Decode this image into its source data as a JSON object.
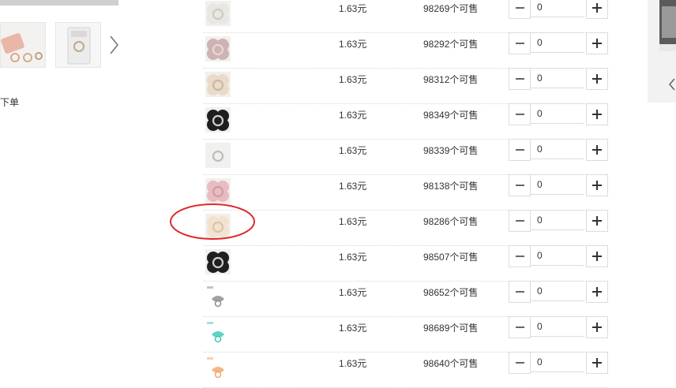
{
  "gallery": {
    "note": "下单"
  },
  "rows": [
    {
      "price": "1.63元",
      "stock": "98269个可售",
      "qty": "0",
      "color": "#e9e7e2",
      "accent": "#cfcac2"
    },
    {
      "price": "1.63元",
      "stock": "98292个可售",
      "qty": "0",
      "color": "#cdb3b3",
      "accent": "#e8d9d3"
    },
    {
      "price": "1.63元",
      "stock": "98312个可售",
      "qty": "0",
      "color": "#eadbc9",
      "accent": "#cbb8a4"
    },
    {
      "price": "1.63元",
      "stock": "98349个可售",
      "qty": "0",
      "color": "#1e1e1e",
      "accent": "#cfcfcf"
    },
    {
      "price": "1.63元",
      "stock": "98339个可售",
      "qty": "0",
      "color": "#f0f0ee",
      "accent": "#bdbdbd"
    },
    {
      "price": "1.63元",
      "stock": "98138个可售",
      "qty": "0",
      "color": "#e8bcc2",
      "accent": "#d59aa4"
    },
    {
      "price": "1.63元",
      "stock": "98286个可售",
      "qty": "0",
      "color": "#f1e3cf",
      "accent": "#d9c6aa"
    },
    {
      "price": "1.63元",
      "stock": "98507个可售",
      "qty": "0",
      "color": "#1f1f1f",
      "accent": "#d0d0d0"
    },
    {
      "price": "1.63元",
      "stock": "98652个可售",
      "qty": "0",
      "color": "#ffffff",
      "accent": "#8a8a8a"
    },
    {
      "price": "1.63元",
      "stock": "98689个可售",
      "qty": "0",
      "color": "#ffffff",
      "accent": "#37c8b6"
    },
    {
      "price": "1.63元",
      "stock": "98640个可售",
      "qty": "0",
      "color": "#ffffff",
      "accent": "#f0a46a"
    }
  ],
  "annotation_color": "#e0292b",
  "icons": {
    "thumb_next": "chevron-right-icon",
    "right_prev": "chevron-left-icon",
    "minus": "minus-icon",
    "plus": "plus-icon"
  }
}
